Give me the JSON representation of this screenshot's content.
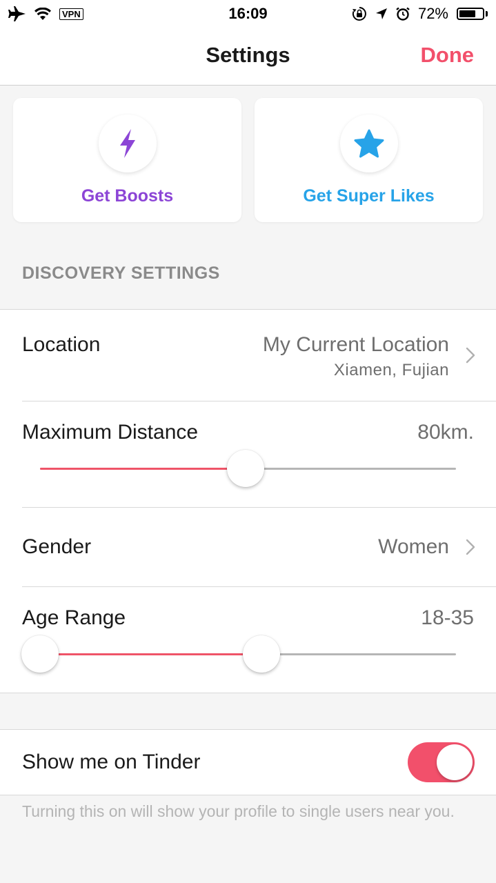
{
  "status_bar": {
    "vpn_label": "VPN",
    "time": "16:09",
    "battery_percent_label": "72%",
    "battery_level": 0.72,
    "icons": [
      "airplane-icon",
      "wifi-icon",
      "orientation-lock-icon",
      "location-arrow-icon",
      "alarm-icon",
      "battery-icon"
    ]
  },
  "nav": {
    "title": "Settings",
    "done_label": "Done"
  },
  "cards": {
    "boosts": {
      "label": "Get Boosts",
      "icon": "lightning-bolt-icon",
      "color": "#8c45d6"
    },
    "super_likes": {
      "label": "Get Super Likes",
      "icon": "star-icon",
      "color": "#27a3e8"
    }
  },
  "discovery": {
    "header": "DISCOVERY SETTINGS",
    "location": {
      "label": "Location",
      "value": "My Current Location",
      "sub_value": "Xiamen, Fujian"
    },
    "max_distance": {
      "label": "Maximum Distance",
      "value": "80km.",
      "slider_fraction": 0.495
    },
    "gender": {
      "label": "Gender",
      "value": "Women"
    },
    "age_range": {
      "label": "Age Range",
      "value": "18-35",
      "slider_low_fraction": 0.0,
      "slider_high_fraction": 0.533
    }
  },
  "show_me": {
    "label": "Show me on Tinder",
    "enabled": true,
    "footnote": "Turning this on will show your profile to single users near you."
  },
  "colors": {
    "accent": "#f2506b",
    "slider_fill": "#ef5468",
    "track": "#b5b5b5",
    "boosts": "#8c45d6",
    "super_likes": "#27a3e8"
  }
}
